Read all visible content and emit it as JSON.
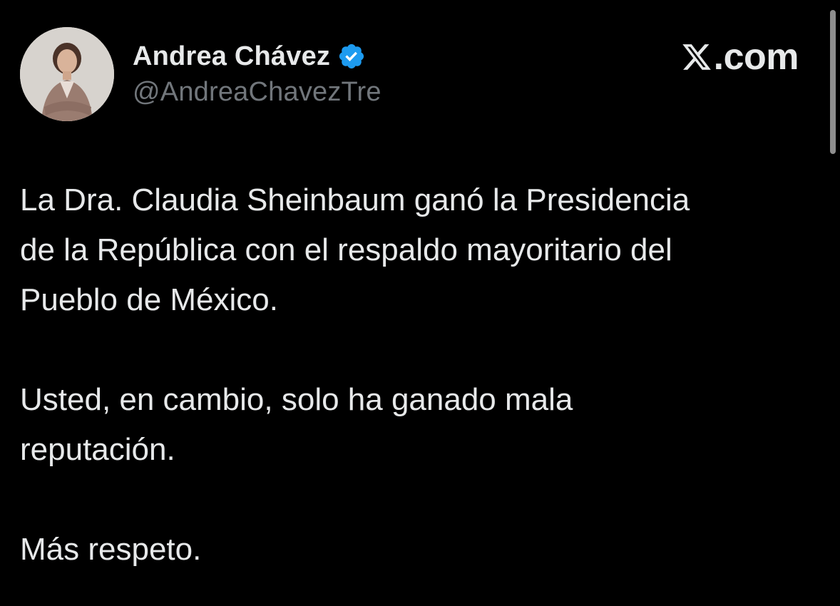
{
  "author": {
    "display_name": "Andrea Chávez",
    "handle": "@AndreaChavezTre",
    "verified": true,
    "verified_icon": "verified-badge-icon",
    "verified_color": "#1d9bf0"
  },
  "brand": {
    "icon": "x-logo-icon",
    "text": ".com"
  },
  "tweet": {
    "paragraphs": [
      {
        "lines": [
          "La Dra. Claudia Sheinbaum ganó la Presidencia",
          "de la República con el respaldo mayoritario del",
          "Pueblo de México."
        ]
      },
      {
        "lines": [
          "Usted, en cambio, solo ha ganado mala",
          "reputación."
        ]
      },
      {
        "lines": [
          "Más respeto."
        ]
      }
    ]
  },
  "theme": {
    "background": "#000000",
    "text": "#e7e9ea",
    "secondary_text": "#71767b"
  }
}
